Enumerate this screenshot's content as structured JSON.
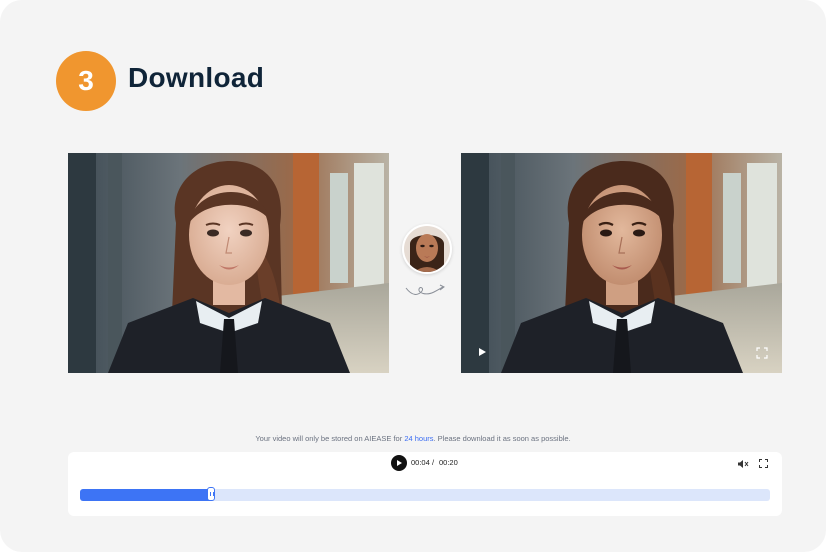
{
  "step": {
    "number": "3",
    "title": "Download"
  },
  "notice": {
    "before": "Your video will only be stored on AIEASE for ",
    "highlight": "24 hours",
    "after": ". Please download it as soon as possible."
  },
  "player": {
    "current_time": "00:04",
    "separator": "/",
    "duration": "00:20",
    "progress_fraction": 0.19
  },
  "icons": {
    "play": "play-icon",
    "fullscreen": "fullscreen-icon",
    "mute": "mute-icon",
    "swap": "swirl-arrow-icon"
  },
  "colors": {
    "accent": "#f0962f",
    "title": "#0f2438",
    "progress": "#3d74f5",
    "track": "#dce6fb",
    "highlight": "#3b6df2"
  }
}
